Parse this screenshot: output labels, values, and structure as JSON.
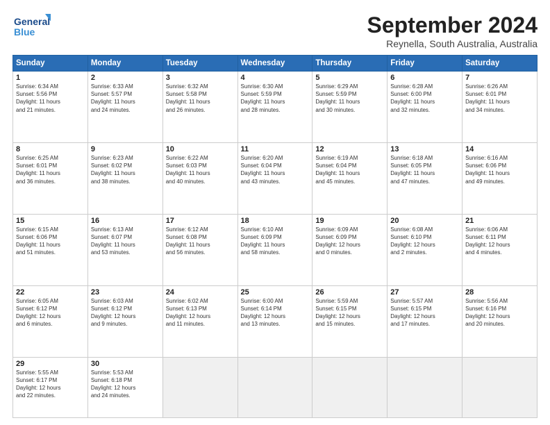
{
  "header": {
    "logo_general": "General",
    "logo_blue": "Blue",
    "title": "September 2024",
    "location": "Reynella, South Australia, Australia"
  },
  "calendar": {
    "days_of_week": [
      "Sunday",
      "Monday",
      "Tuesday",
      "Wednesday",
      "Thursday",
      "Friday",
      "Saturday"
    ],
    "weeks": [
      [
        {
          "num": "",
          "info": ""
        },
        {
          "num": "2",
          "info": "Sunrise: 6:33 AM\nSunset: 5:57 PM\nDaylight: 11 hours\nand 24 minutes."
        },
        {
          "num": "3",
          "info": "Sunrise: 6:32 AM\nSunset: 5:58 PM\nDaylight: 11 hours\nand 26 minutes."
        },
        {
          "num": "4",
          "info": "Sunrise: 6:30 AM\nSunset: 5:59 PM\nDaylight: 11 hours\nand 28 minutes."
        },
        {
          "num": "5",
          "info": "Sunrise: 6:29 AM\nSunset: 5:59 PM\nDaylight: 11 hours\nand 30 minutes."
        },
        {
          "num": "6",
          "info": "Sunrise: 6:28 AM\nSunset: 6:00 PM\nDaylight: 11 hours\nand 32 minutes."
        },
        {
          "num": "7",
          "info": "Sunrise: 6:26 AM\nSunset: 6:01 PM\nDaylight: 11 hours\nand 34 minutes."
        }
      ],
      [
        {
          "num": "8",
          "info": "Sunrise: 6:25 AM\nSunset: 6:01 PM\nDaylight: 11 hours\nand 36 minutes."
        },
        {
          "num": "9",
          "info": "Sunrise: 6:23 AM\nSunset: 6:02 PM\nDaylight: 11 hours\nand 38 minutes."
        },
        {
          "num": "10",
          "info": "Sunrise: 6:22 AM\nSunset: 6:03 PM\nDaylight: 11 hours\nand 40 minutes."
        },
        {
          "num": "11",
          "info": "Sunrise: 6:20 AM\nSunset: 6:04 PM\nDaylight: 11 hours\nand 43 minutes."
        },
        {
          "num": "12",
          "info": "Sunrise: 6:19 AM\nSunset: 6:04 PM\nDaylight: 11 hours\nand 45 minutes."
        },
        {
          "num": "13",
          "info": "Sunrise: 6:18 AM\nSunset: 6:05 PM\nDaylight: 11 hours\nand 47 minutes."
        },
        {
          "num": "14",
          "info": "Sunrise: 6:16 AM\nSunset: 6:06 PM\nDaylight: 11 hours\nand 49 minutes."
        }
      ],
      [
        {
          "num": "15",
          "info": "Sunrise: 6:15 AM\nSunset: 6:06 PM\nDaylight: 11 hours\nand 51 minutes."
        },
        {
          "num": "16",
          "info": "Sunrise: 6:13 AM\nSunset: 6:07 PM\nDaylight: 11 hours\nand 53 minutes."
        },
        {
          "num": "17",
          "info": "Sunrise: 6:12 AM\nSunset: 6:08 PM\nDaylight: 11 hours\nand 56 minutes."
        },
        {
          "num": "18",
          "info": "Sunrise: 6:10 AM\nSunset: 6:09 PM\nDaylight: 11 hours\nand 58 minutes."
        },
        {
          "num": "19",
          "info": "Sunrise: 6:09 AM\nSunset: 6:09 PM\nDaylight: 12 hours\nand 0 minutes."
        },
        {
          "num": "20",
          "info": "Sunrise: 6:08 AM\nSunset: 6:10 PM\nDaylight: 12 hours\nand 2 minutes."
        },
        {
          "num": "21",
          "info": "Sunrise: 6:06 AM\nSunset: 6:11 PM\nDaylight: 12 hours\nand 4 minutes."
        }
      ],
      [
        {
          "num": "22",
          "info": "Sunrise: 6:05 AM\nSunset: 6:12 PM\nDaylight: 12 hours\nand 6 minutes."
        },
        {
          "num": "23",
          "info": "Sunrise: 6:03 AM\nSunset: 6:12 PM\nDaylight: 12 hours\nand 9 minutes."
        },
        {
          "num": "24",
          "info": "Sunrise: 6:02 AM\nSunset: 6:13 PM\nDaylight: 12 hours\nand 11 minutes."
        },
        {
          "num": "25",
          "info": "Sunrise: 6:00 AM\nSunset: 6:14 PM\nDaylight: 12 hours\nand 13 minutes."
        },
        {
          "num": "26",
          "info": "Sunrise: 5:59 AM\nSunset: 6:15 PM\nDaylight: 12 hours\nand 15 minutes."
        },
        {
          "num": "27",
          "info": "Sunrise: 5:57 AM\nSunset: 6:15 PM\nDaylight: 12 hours\nand 17 minutes."
        },
        {
          "num": "28",
          "info": "Sunrise: 5:56 AM\nSunset: 6:16 PM\nDaylight: 12 hours\nand 20 minutes."
        }
      ],
      [
        {
          "num": "29",
          "info": "Sunrise: 5:55 AM\nSunset: 6:17 PM\nDaylight: 12 hours\nand 22 minutes."
        },
        {
          "num": "30",
          "info": "Sunrise: 5:53 AM\nSunset: 6:18 PM\nDaylight: 12 hours\nand 24 minutes."
        },
        {
          "num": "",
          "info": ""
        },
        {
          "num": "",
          "info": ""
        },
        {
          "num": "",
          "info": ""
        },
        {
          "num": "",
          "info": ""
        },
        {
          "num": "",
          "info": ""
        }
      ]
    ],
    "week0_sun": {
      "num": "1",
      "info": "Sunrise: 6:34 AM\nSunset: 5:56 PM\nDaylight: 11 hours\nand 21 minutes."
    }
  }
}
